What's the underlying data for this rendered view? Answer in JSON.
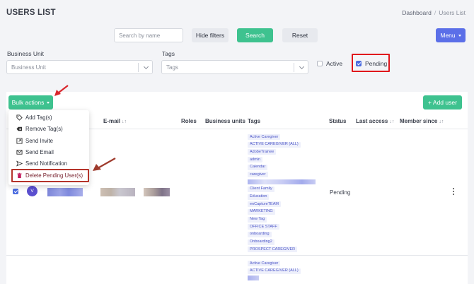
{
  "page": {
    "title": "USERS LIST",
    "breadcrumb": {
      "home": "Dashboard",
      "separator": "/",
      "current": "Users List"
    }
  },
  "filters": {
    "search_placeholder": "Search by name",
    "hide_filters_label": "Hide filters",
    "search_label": "Search",
    "reset_label": "Reset",
    "menu_label": "Menu",
    "business_unit": {
      "label": "Business Unit",
      "placeholder": "Business Unit"
    },
    "tags": {
      "label": "Tags",
      "placeholder": "Tags"
    },
    "active": {
      "label": "Active",
      "checked": false
    },
    "pending": {
      "label": "Pending",
      "checked": true
    }
  },
  "toolbar": {
    "bulk_actions_label": "Bulk actions",
    "add_user_label": "+ Add user"
  },
  "bulk_menu": {
    "items": [
      {
        "label": "Add Tag(s)",
        "icon": "tag-icon"
      },
      {
        "label": "Remove Tag(s)",
        "icon": "tag-remove-icon"
      },
      {
        "label": "Send Invite",
        "icon": "invite-icon"
      },
      {
        "label": "Send Email",
        "icon": "envelope-icon"
      },
      {
        "label": "Send Notification",
        "icon": "send-icon"
      },
      {
        "label": "Delete Pending User(s)",
        "icon": "trash-icon"
      }
    ]
  },
  "table": {
    "columns": {
      "email": "E-mail",
      "roles": "Roles",
      "business_units": "Business units",
      "tags": "Tags",
      "status": "Status",
      "last_access": "Last access",
      "member_since": "Member since",
      "sort_glyph": "↓↑"
    },
    "rows": [
      {
        "avatar_initial": "V",
        "checked": true,
        "status": "Pending",
        "tags": [
          "Active Caregiver",
          "ACTIVE CAREGIVER (ALL)",
          "AdobeTrainee",
          "admin",
          "Calendar",
          "caregiver",
          "Client Family",
          "Education",
          "enCaptureTEAM",
          "MARKETING",
          "New Tag",
          "OFFICE STAFF",
          "onboarding",
          "Onboarding2",
          "PROSPECT CAREGIVER"
        ]
      },
      {
        "tags": [
          "Active Caregiver",
          "ACTIVE CAREGIVER (ALL)"
        ]
      }
    ]
  },
  "colors": {
    "primary_green": "#3ec28f",
    "menu_blue": "#5b6fe8",
    "highlight_red": "#e0161c",
    "highlight_dark_red": "#b5342b",
    "tag_text": "#4b55c7",
    "tag_bg": "#eef0fb"
  }
}
